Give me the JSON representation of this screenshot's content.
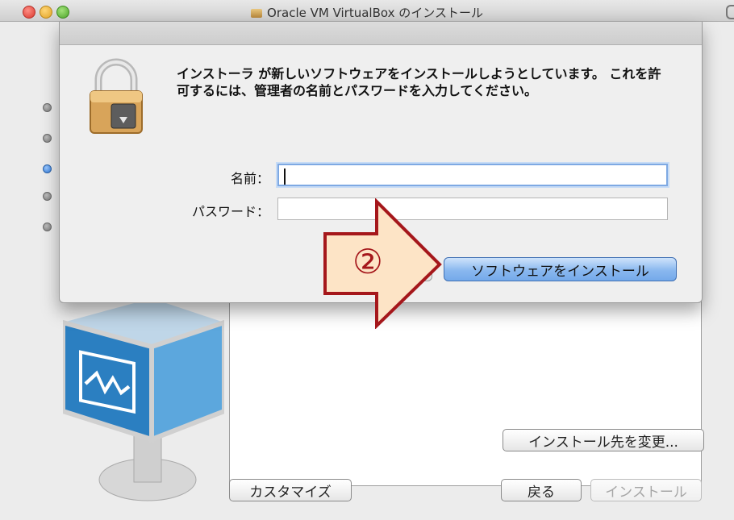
{
  "window": {
    "title": "Oracle VM VirtualBox のインストール"
  },
  "steps": {
    "count": 5,
    "active_index": 2
  },
  "main": {
    "change_location_label": "インストール先を変更...",
    "customize_label": "カスタマイズ",
    "back_label": "戻る",
    "install_label": "インストール"
  },
  "auth_sheet": {
    "message": "インストーラ が新しいソフトウェアをインストールしようとしています。 これを許可するには、管理者の名前とパスワードを入力してください。",
    "name_label": "名前：",
    "name_value": "",
    "password_label": "パスワード：",
    "password_value": "",
    "install_software_label": "ソフトウェアをインストール"
  },
  "annotation": {
    "step_marker": "②",
    "color": "#a5171b"
  },
  "colors": {
    "default_button": "#8ab8ef",
    "focus_ring": "#7ea9e3"
  }
}
